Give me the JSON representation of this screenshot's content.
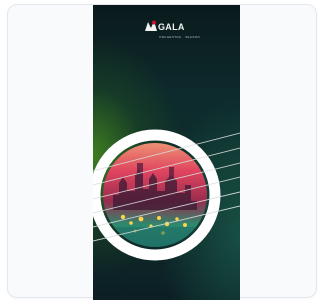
{
  "poster": {
    "brand_name": "GALA",
    "brand_tagline": "ORCHESTRA · SEASON",
    "icon": "guitar-soundhole-illustration"
  },
  "colors": {
    "card_border": "#e3e8ef",
    "card_background": "#f9fafc",
    "poster_background": "#0d2a2c",
    "ring": "#ffffff",
    "logo_accent": "#c8102e"
  }
}
